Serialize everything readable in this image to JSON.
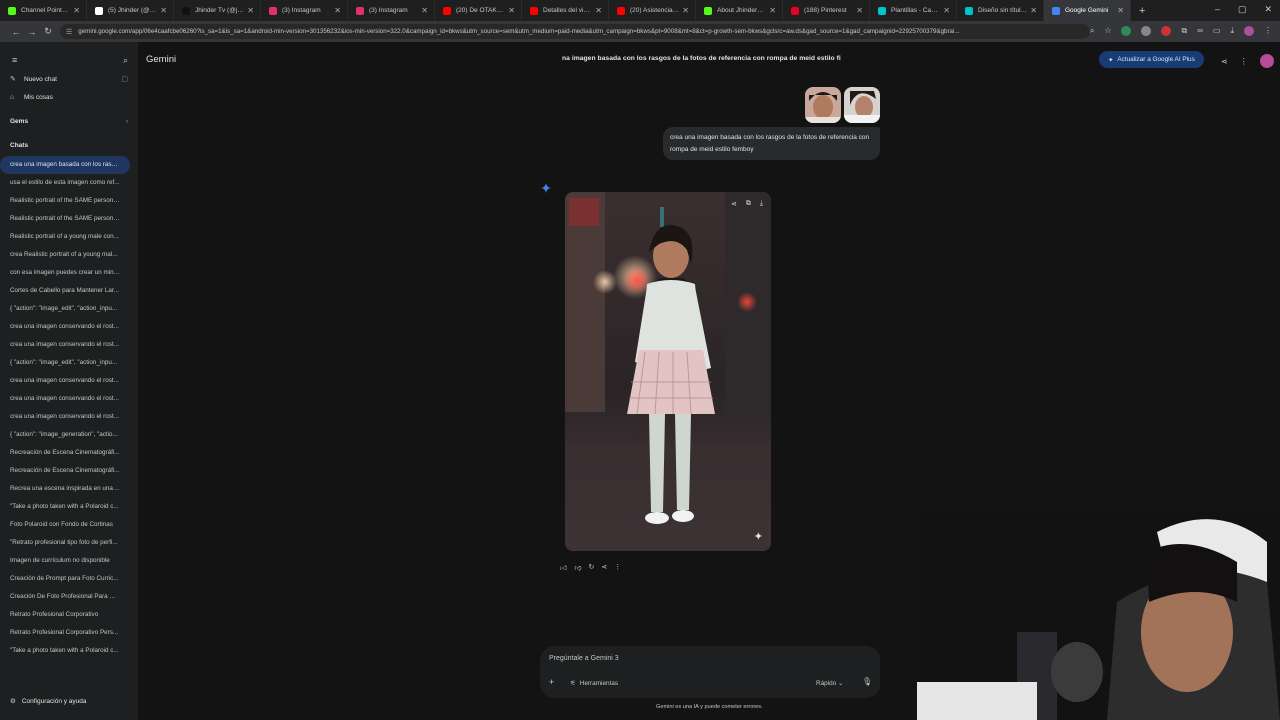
{
  "browser": {
    "tabs": [
      {
        "title": "Channel Points - Ki",
        "color": "#53fc18"
      },
      {
        "title": "(5) Jhinder (@Jhind",
        "color": "#ffffff"
      },
      {
        "title": "Jhinder Tv (@jhind",
        "color": "#111111"
      },
      {
        "title": "(3) Instagram",
        "color": "#e1306c"
      },
      {
        "title": "(3) Instagram",
        "color": "#e1306c"
      },
      {
        "title": "(20) De OTAKU a U",
        "color": "#ff0000"
      },
      {
        "title": "Detalles del video -",
        "color": "#ff0000"
      },
      {
        "title": "(20) Asistencia histó",
        "color": "#ff0000"
      },
      {
        "title": "About Jhinder_Tv -",
        "color": "#53fc18"
      },
      {
        "title": "(188) Pinterest",
        "color": "#e60023"
      },
      {
        "title": "Plantillas - Canva",
        "color": "#00c4cc"
      },
      {
        "title": "Diseño sin título -",
        "color": "#00c4cc"
      },
      {
        "title": "Google Gemini",
        "color": "#4285f4"
      }
    ],
    "url": "gemini.google.com/app/06e4caafcbe06260?is_sa=1&is_sa=1&android-min-version=301356232&ios-min-version=322.0&campaign_id=bkws&utm_source=sem&utm_medium=paid-media&utm_campaign=bkws&pt=9008&mt=8&ct=p-growth-sem-bkws&gclsrc=aw.ds&gad_source=1&gad_campaignid=22925700379&gbrai..."
  },
  "sidebar": {
    "new_chat": "Nuevo chat",
    "my_stuff": "Mis cosas",
    "gems": "Gems",
    "chats_header": "Chats",
    "chats": [
      "crea una imagen basada con los rasg...",
      "usa el estilo de esta imagen como ref...",
      "Realistic portrait of the SAME person ...",
      "Realistic portrait of the SAME person ...",
      "Realistic portrait of a young male con...",
      "crea Realistic portrait of a young mal...",
      "con esa imagen puedes crear un mini...",
      "Cortes de Cabello para Mantener Lar...",
      "{ \"action\": \"image_edit\", \"action_inpu...",
      "crea una imagen conservando el rost...",
      "crea una imagen conservando el rost...",
      "{ \"action\": \"image_edit\", \"action_inpu...",
      "crea una imagen conservando el rost...",
      "crea una imagen conservando el rost...",
      "crea una imagen conservando el rost...",
      "{ \"action\": \"image_generation\", \"actio...",
      "Recreación de Escena Cinematográfi...",
      "Recreación de Escena Cinematográfi...",
      "Recrea una escena inspirada en una s...",
      "\"Take a photo taken with a Polaroid c...",
      "Foto Polaroid con Fondo de Cortinas",
      "\"Retrato profesional tipo foto de perfi...",
      "Imagen de currículum no disponible",
      "Creación de Prompt para Foto Curric...",
      "Creación De Foto Profesional Para Cu...",
      "Retrato Profesional Corporativo",
      "Retrato Profesional Corporativo Pers...",
      "\"Take a photo taken with a Polaroid c..."
    ],
    "settings": "Configuración y ayuda"
  },
  "main": {
    "brand": "Gemini",
    "conversation_title": "na imagen basada con los rasgos de la fotos de referencia con rompa de meid estilo fi",
    "upgrade_label": "Actualizar a Google AI Plus",
    "user_message": "crea una imagen basada con los rasgos de la fotos de referencia con rompa de meid estilo femboy",
    "input_placeholder": "Pregúntale a Gemini 3",
    "tools_label": "Herramientas",
    "mode_label": "Rápido",
    "disclaimer": "Gemini es una IA y puede cometer errores."
  },
  "colors": {
    "background": "#131314",
    "sidebar": "#1e1f20",
    "active_chat": "#1f3760",
    "upgrade_button": "#1a3c74",
    "accent_blue": "#4285f4"
  }
}
